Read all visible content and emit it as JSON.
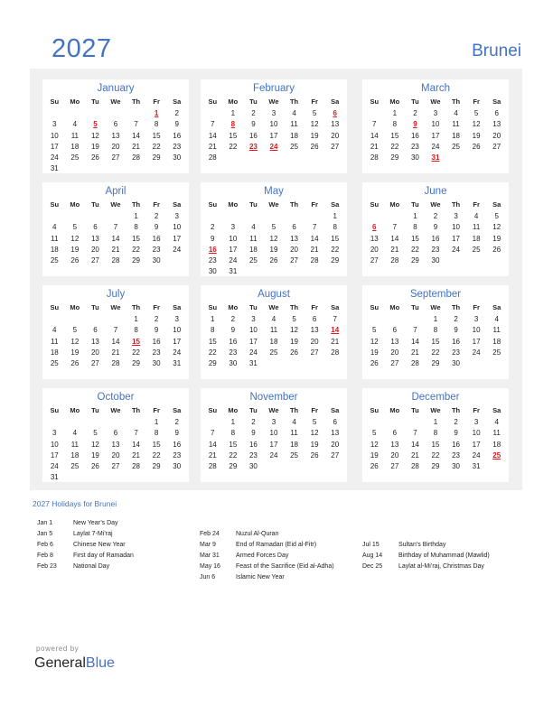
{
  "header": {
    "year": "2027",
    "country": "Brunei"
  },
  "weekdays": [
    "Su",
    "Mo",
    "Tu",
    "We",
    "Th",
    "Fr",
    "Sa"
  ],
  "months": [
    {
      "name": "January",
      "start": 5,
      "days": 31,
      "holidays": [
        1,
        5
      ]
    },
    {
      "name": "February",
      "start": 1,
      "days": 28,
      "holidays": [
        6,
        8,
        23,
        24
      ]
    },
    {
      "name": "March",
      "start": 1,
      "days": 31,
      "holidays": [
        9,
        31
      ]
    },
    {
      "name": "April",
      "start": 4,
      "days": 30,
      "holidays": []
    },
    {
      "name": "May",
      "start": 6,
      "days": 31,
      "holidays": [
        16
      ]
    },
    {
      "name": "June",
      "start": 2,
      "days": 30,
      "holidays": [
        6
      ]
    },
    {
      "name": "July",
      "start": 4,
      "days": 31,
      "holidays": [
        15
      ]
    },
    {
      "name": "August",
      "start": 0,
      "days": 31,
      "holidays": [
        14
      ]
    },
    {
      "name": "September",
      "start": 3,
      "days": 30,
      "holidays": []
    },
    {
      "name": "October",
      "start": 5,
      "days": 31,
      "holidays": []
    },
    {
      "name": "November",
      "start": 1,
      "days": 30,
      "holidays": []
    },
    {
      "name": "December",
      "start": 3,
      "days": 31,
      "holidays": [
        25
      ]
    }
  ],
  "holidays_title": "2027 Holidays for Brunei",
  "holidays": [
    [
      {
        "date": "Jan 1",
        "name": "New Year’s Day"
      },
      {
        "date": "Jan 5",
        "name": "Laylat 7-Mi’raj"
      },
      {
        "date": "Feb 6",
        "name": "Chinese New Year"
      },
      {
        "date": "Feb 8",
        "name": "First day of Ramadan"
      },
      {
        "date": "Feb 23",
        "name": "National Day"
      }
    ],
    [
      {
        "date": "Feb 24",
        "name": "Nuzul Al-Quran"
      },
      {
        "date": "Mar 9",
        "name": "End of Ramadan (Eid al-Fitr)"
      },
      {
        "date": "Mar 31",
        "name": "Armed Forces Day"
      },
      {
        "date": "May 16",
        "name": "Feast of the Sacrifice (Eid al-Adha)"
      },
      {
        "date": "Jun 6",
        "name": "Islamic New Year"
      }
    ],
    [
      {
        "date": "Jul 15",
        "name": "Sultan’s Birthday"
      },
      {
        "date": "Aug 14",
        "name": "Birthday of Muhammad (Mawlid)"
      },
      {
        "date": "Dec 25",
        "name": "Laylat al-Mi’raj, Christmas Day"
      }
    ]
  ],
  "footer": {
    "powered_by": "powered by",
    "brand_part1": "General",
    "brand_part2": "Blue"
  },
  "colors": {
    "accent": "#4472c4",
    "holiday": "#e0161c",
    "panel": "#f0f0f0"
  }
}
